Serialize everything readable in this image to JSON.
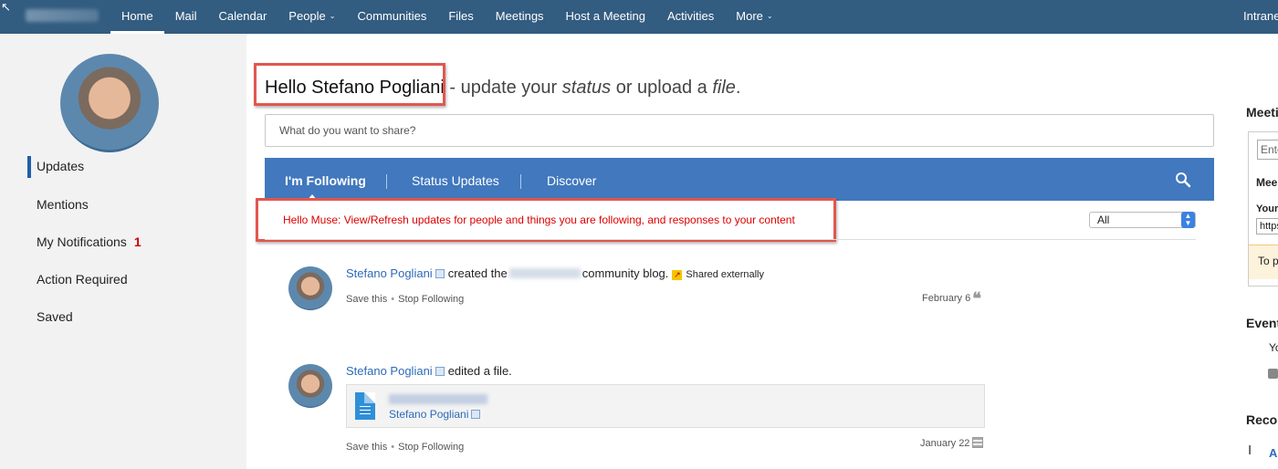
{
  "topbar": {
    "nav": [
      {
        "label": "Home",
        "active": true,
        "dropdown": false
      },
      {
        "label": "Mail",
        "active": false,
        "dropdown": false
      },
      {
        "label": "Calendar",
        "active": false,
        "dropdown": false
      },
      {
        "label": "People",
        "active": false,
        "dropdown": true
      },
      {
        "label": "Communities",
        "active": false,
        "dropdown": false
      },
      {
        "label": "Files",
        "active": false,
        "dropdown": false
      },
      {
        "label": "Meetings",
        "active": false,
        "dropdown": false
      },
      {
        "label": "Host a Meeting",
        "active": false,
        "dropdown": false
      },
      {
        "label": "Activities",
        "active": false,
        "dropdown": false
      },
      {
        "label": "More",
        "active": false,
        "dropdown": true
      }
    ],
    "right_label": "Intranet",
    "chevron": "⌄"
  },
  "sidebar": {
    "items": [
      {
        "label": "Updates"
      },
      {
        "label": "Mentions"
      },
      {
        "label": "My Notifications",
        "count": "1"
      },
      {
        "label": "Action Required"
      },
      {
        "label": "Saved"
      }
    ]
  },
  "greeting": {
    "hello": "Hello Stefano Pogliani",
    "separator": " - ",
    "prefix": "update your ",
    "status": "status",
    "middle": " or upload a ",
    "file": "file",
    "suffix": "."
  },
  "share": {
    "placeholder": "What do you want to share?"
  },
  "tabs": {
    "items": [
      "I'm Following",
      "Status Updates",
      "Discover"
    ]
  },
  "info_message": "Hello Muse: View/Refresh updates for people and things you are following, and responses to your content",
  "filter": {
    "selected": "All"
  },
  "posts": [
    {
      "author": "Stefano Pogliani",
      "action_before": "created the",
      "action_after": "community blog.",
      "shared": "Shared externally",
      "save": "Save this",
      "stop": "Stop Following",
      "separator": "•",
      "date": "February 6",
      "quote": "❝"
    },
    {
      "author": "Stefano Pogliani",
      "action_before": "edited a file.",
      "file_owner": "Stefano Pogliani",
      "save": "Save this",
      "stop": "Stop Following",
      "separator": "•",
      "date": "January 22"
    }
  ],
  "right_column": {
    "meetings_heading": "Meeti",
    "input_value": "Ente",
    "meeting_label": "Mee",
    "your_label": "Your",
    "url_value": "https",
    "warning": "To p",
    "events_heading": "Event",
    "events_text": "Yo",
    "recommend_heading": "Reco",
    "recommend_link": "Ap",
    "cursor_glyph": "I"
  },
  "icons": {
    "search": "search-icon",
    "cursor": "↖"
  },
  "colors": {
    "topbar": "#325c80",
    "tabbar": "#4178be",
    "highlight_box": "#e1574f",
    "link": "#2e6ab8",
    "notification": "#cc0000"
  }
}
